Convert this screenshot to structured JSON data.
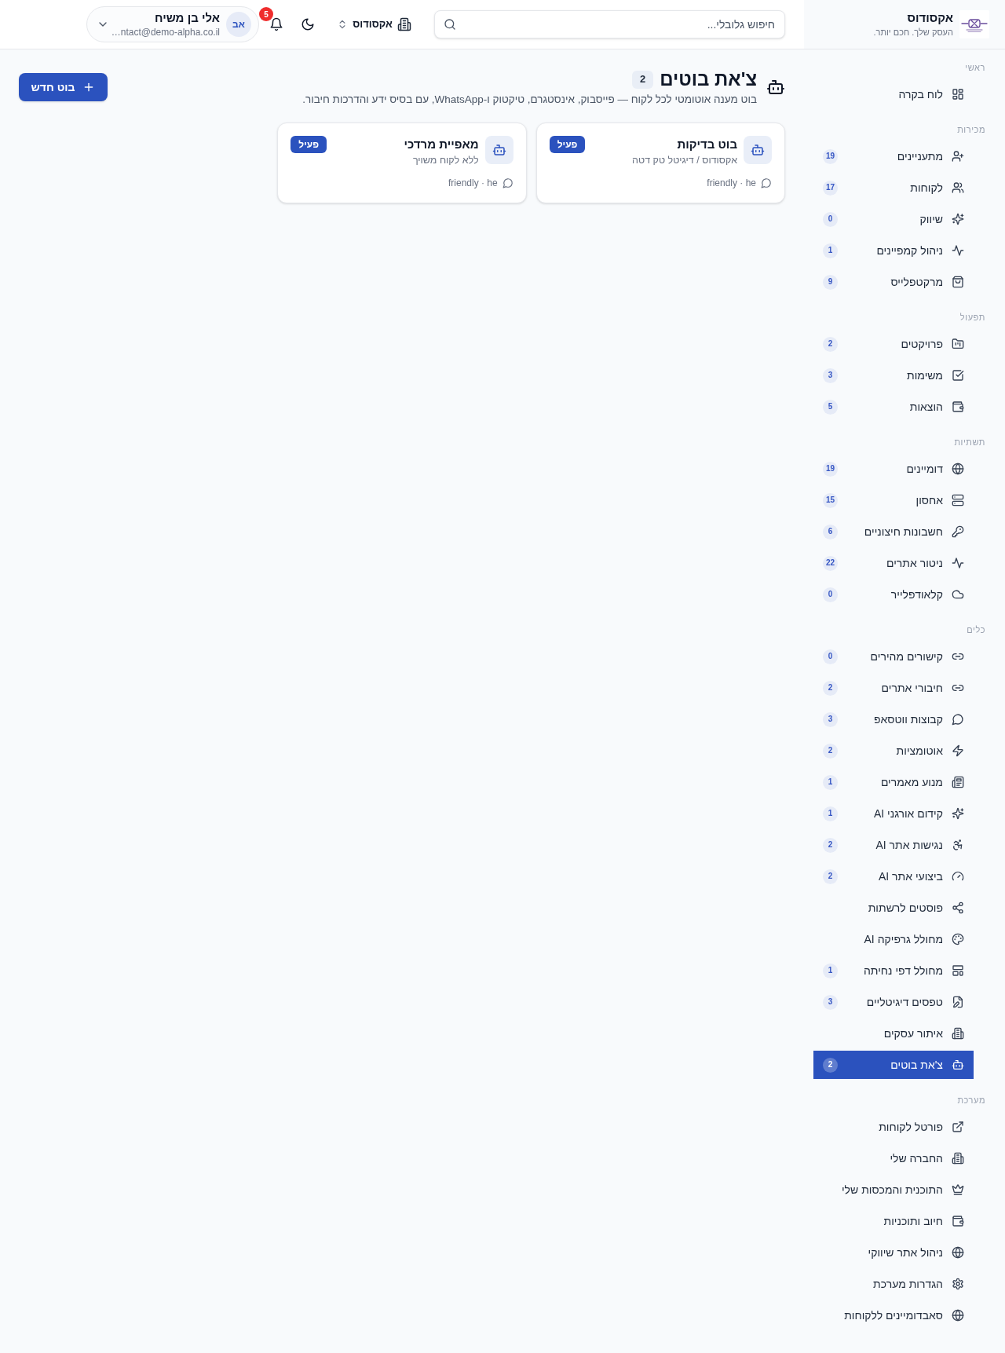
{
  "sidebar": {
    "brand": {
      "name": "אקסודוס",
      "tagline": "העסק שלך. חכם יותר."
    },
    "sections": [
      {
        "label": "ראשי",
        "items": [
          {
            "label": "לוח בקרה",
            "selected": false
          }
        ]
      },
      {
        "label": "מכירות",
        "items": [
          {
            "label": "מתעניינים",
            "count": "19",
            "selected": false
          },
          {
            "label": "לקוחות",
            "count": "17",
            "selected": false
          },
          {
            "label": "שיווק",
            "count": "0",
            "selected": false
          },
          {
            "label": "ניהול קמפיינים",
            "count": "1",
            "selected": false
          },
          {
            "label": "מרקטפלייס",
            "count": "9",
            "selected": false
          }
        ]
      },
      {
        "label": "תפעול",
        "items": [
          {
            "label": "פרויקטים",
            "count": "2",
            "selected": false
          },
          {
            "label": "משימות",
            "count": "3",
            "selected": false
          },
          {
            "label": "הוצאות",
            "count": "5",
            "selected": false
          }
        ]
      },
      {
        "label": "תשתיות",
        "items": [
          {
            "label": "דומיינים",
            "count": "19",
            "selected": false
          },
          {
            "label": "אחסון",
            "count": "15",
            "selected": false
          },
          {
            "label": "חשבונות חיצוניים",
            "count": "6",
            "selected": false
          },
          {
            "label": "ניטור אתרים",
            "count": "22",
            "selected": false
          },
          {
            "label": "קלאודפלייר",
            "count": "0",
            "selected": false
          }
        ]
      },
      {
        "label": "כלים",
        "items": [
          {
            "label": "קישורים מהירים",
            "count": "0",
            "selected": false
          },
          {
            "label": "חיבורי אתרים",
            "count": "2",
            "selected": false
          },
          {
            "label": "קבוצות ווטסאפ",
            "count": "3",
            "selected": false
          },
          {
            "label": "אוטומציות",
            "count": "2",
            "selected": false
          },
          {
            "label": "מנוע מאמרים",
            "count": "1",
            "selected": false
          },
          {
            "label": "קידום אורגני AI",
            "count": "1",
            "selected": false
          },
          {
            "label": "נגישות אתר AI",
            "count": "2",
            "selected": false
          },
          {
            "label": "ביצועי אתר AI",
            "count": "2",
            "selected": false
          },
          {
            "label": "פוסטים לרשתות",
            "selected": false
          },
          {
            "label": "מחולל גרפיקה AI",
            "selected": false
          },
          {
            "label": "מחולל דפי נחיתה",
            "count": "1",
            "selected": false
          },
          {
            "label": "טפסים דיגיטליים",
            "count": "3",
            "selected": false
          },
          {
            "label": "איתור עסקים",
            "selected": false
          },
          {
            "label": "צ'את בוטים",
            "count": "2",
            "selected": true
          }
        ]
      },
      {
        "label": "מערכת",
        "items": [
          {
            "label": "פורטל לקוחות",
            "selected": false
          },
          {
            "label": "החברה שלי",
            "selected": false
          },
          {
            "label": "התוכנית והמכסות שלי",
            "selected": false
          },
          {
            "label": "חיוב ותוכניות",
            "selected": false
          },
          {
            "label": "ניהול אתר שיווקי",
            "selected": false
          },
          {
            "label": "הגדרות מערכת",
            "selected": false
          },
          {
            "label": "סאבדומיינים ללקוחות",
            "selected": false
          }
        ]
      }
    ]
  },
  "top_bar": {
    "search": {
      "placeholder": "חיפוש גלובלי..."
    },
    "company": "אקסודוס",
    "notifications": "5",
    "user": {
      "initials": "אב",
      "name": "אלי בן משיח",
      "email": "…ntact@demo-alpha.co.il"
    }
  },
  "page": {
    "title": "צ'את בוטים",
    "count": "2",
    "description": "בוט מענה אוטומטי לכל לקוח — פייסבוק, אינסטגרם, טיקטוק ו-WhatsApp, עם בסיס ידע והדרכות חיבור.",
    "new_button": "בוט חדש"
  },
  "bots": [
    {
      "name": "בוט בדיקות",
      "subtitle": "אקסודוס / דיגיטל טק דטה",
      "status": "פעיל",
      "meta": "friendly · he"
    },
    {
      "name": "מאפיית מרדכי",
      "subtitle": "ללא לקוח משויך",
      "status": "פעיל",
      "meta": "friendly · he"
    }
  ]
}
